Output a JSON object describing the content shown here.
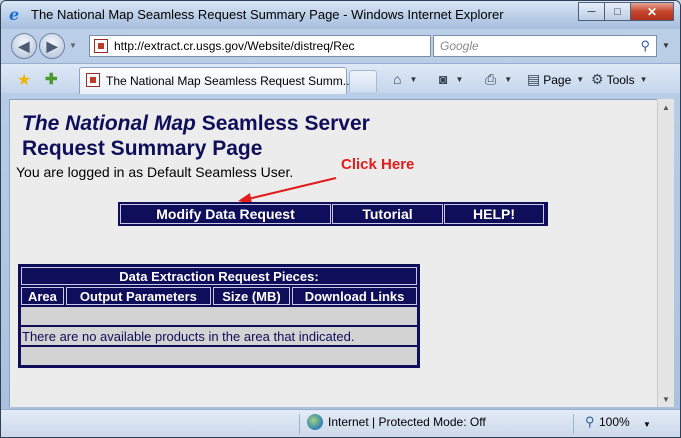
{
  "window": {
    "title": "The National Map Seamless Request Summary Page - Windows Internet Explorer",
    "minimize_label": "─",
    "maximize_label": "□",
    "close_label": "✕"
  },
  "address_bar": {
    "url": "http://extract.cr.usgs.gov/Website/distreq/Rec",
    "search_placeholder": "Google"
  },
  "tab": {
    "label": "The National Map Seamless Request Summ..."
  },
  "toolbar": {
    "page_label": "Page",
    "tools_label": "Tools"
  },
  "page": {
    "header_italic": "The National Map",
    "header_rest": " Seamless Server",
    "header_line2": "Request Summary Page",
    "logged_in": "You are logged in as Default Seamless User.",
    "annotation": "Click Here",
    "nav": {
      "modify": "Modify Data Request",
      "tutorial": "Tutorial",
      "help": "HELP!"
    },
    "table": {
      "title": "Data Extraction Request Pieces:",
      "columns": [
        "Area",
        "Output Parameters",
        "Size (MB)",
        "Download Links"
      ],
      "message": "There are no available products in the area that indicated."
    }
  },
  "status": {
    "zone": "Internet | Protected Mode: Off",
    "zoom": "100%"
  },
  "colors": {
    "navy": "#0e0e5a",
    "annotation_red": "#e21b1b",
    "cell_gray": "#d3d3d3"
  }
}
